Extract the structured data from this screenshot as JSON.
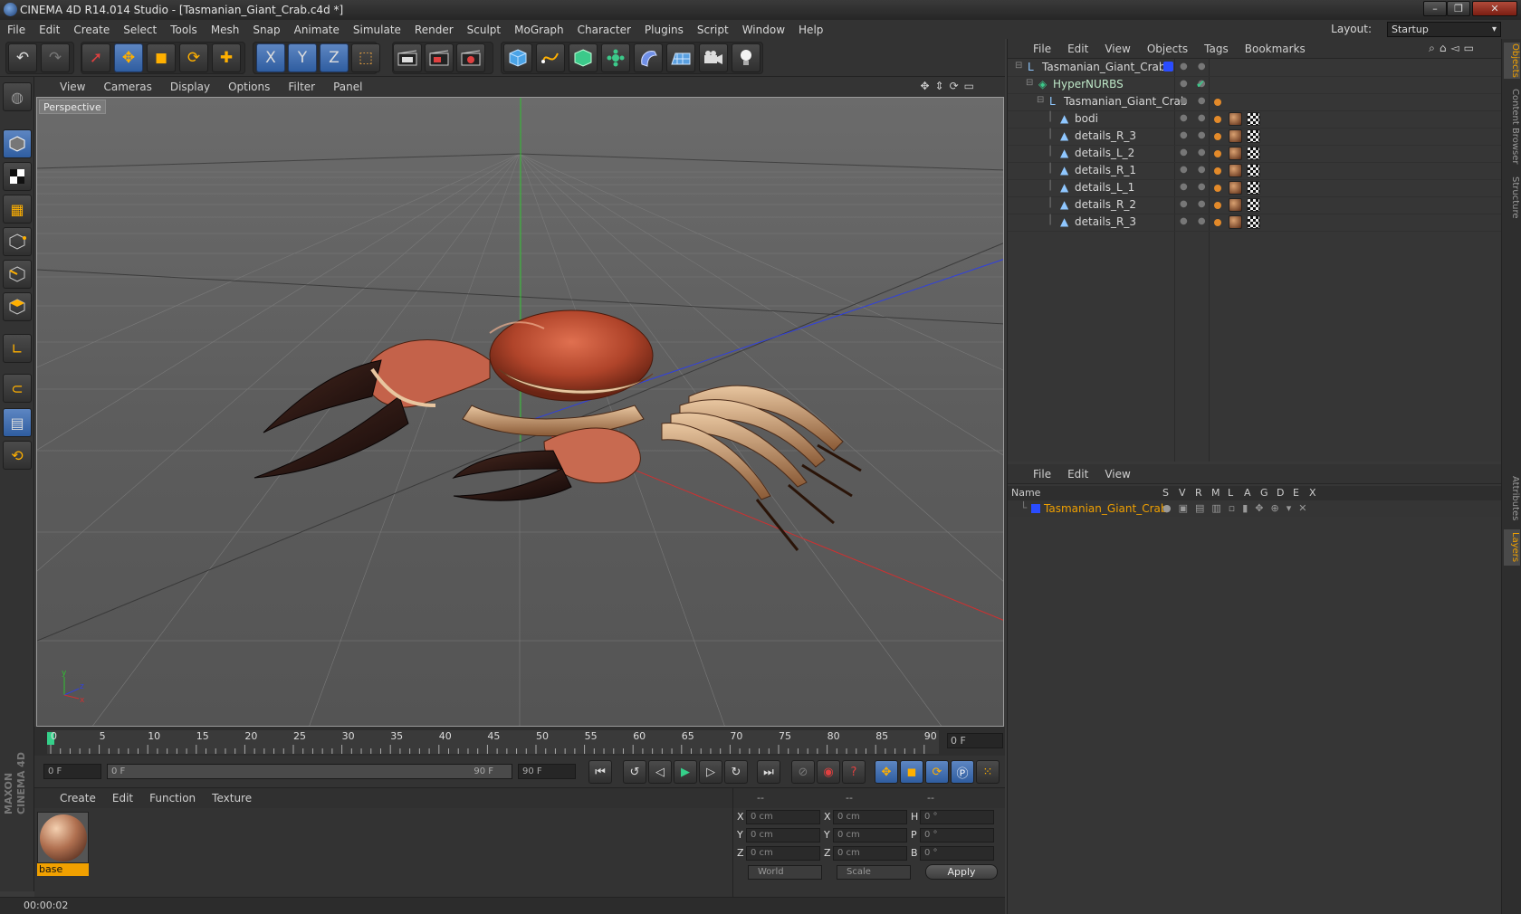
{
  "window": {
    "title": "CINEMA 4D R14.014 Studio - [Tasmanian_Giant_Crab.c4d *]",
    "minimize": "–",
    "restore": "❐",
    "close": "✕"
  },
  "menubar": {
    "items": [
      "File",
      "Edit",
      "Create",
      "Select",
      "Tools",
      "Mesh",
      "Snap",
      "Animate",
      "Simulate",
      "Render",
      "Sculpt",
      "MoGraph",
      "Character",
      "Plugins",
      "Script",
      "Window",
      "Help"
    ],
    "layout_label": "Layout:",
    "layout_value": "Startup"
  },
  "toolbar": {
    "undo": "↶",
    "redo": "↷",
    "select": "➚",
    "move": "✥",
    "scale": "◼",
    "rotate": "⟳",
    "add": "✚",
    "axis_x": "X",
    "axis_y": "Y",
    "axis_z": "Z",
    "coord": "⬚"
  },
  "viewport": {
    "menu": [
      "View",
      "Cameras",
      "Display",
      "Options",
      "Filter",
      "Panel"
    ],
    "label": "Perspective"
  },
  "timeline": {
    "ticks": [
      "0",
      "5",
      "10",
      "15",
      "20",
      "25",
      "30",
      "35",
      "40",
      "45",
      "50",
      "55",
      "60",
      "65",
      "70",
      "75",
      "80",
      "85",
      "90"
    ],
    "current_frame": "0 F",
    "start_field": "0 F",
    "range_start": "0 F",
    "range_end": "90 F",
    "end_field": "90 F"
  },
  "materials": {
    "menu": [
      "Create",
      "Edit",
      "Function",
      "Texture"
    ],
    "items": [
      {
        "name": "base"
      }
    ]
  },
  "coordinates": {
    "headers": [
      "--",
      "--",
      "--"
    ],
    "rows": [
      {
        "l1": "X",
        "v1": "0 cm",
        "l2": "X",
        "v2": "0 cm",
        "l3": "H",
        "v3": "0 °"
      },
      {
        "l1": "Y",
        "v1": "0 cm",
        "l2": "Y",
        "v2": "0 cm",
        "l3": "P",
        "v3": "0 °"
      },
      {
        "l1": "Z",
        "v1": "0 cm",
        "l2": "Z",
        "v2": "0 cm",
        "l3": "B",
        "v3": "0 °"
      }
    ],
    "space": "World",
    "mode": "Scale",
    "apply": "Apply"
  },
  "status": {
    "text": "00:00:02"
  },
  "objects_panel": {
    "menu": [
      "File",
      "Edit",
      "View",
      "Objects",
      "Tags",
      "Bookmarks"
    ],
    "tree": [
      {
        "name": "Tasmanian_Giant_Crab",
        "depth": 0,
        "type": "null"
      },
      {
        "name": "HyperNURBS",
        "depth": 1,
        "type": "nurbs"
      },
      {
        "name": "Tasmanian_Giant_Crab",
        "depth": 2,
        "type": "null"
      },
      {
        "name": "bodi",
        "depth": 3,
        "type": "mesh"
      },
      {
        "name": "details_R_3",
        "depth": 3,
        "type": "mesh"
      },
      {
        "name": "details_L_2",
        "depth": 3,
        "type": "mesh"
      },
      {
        "name": "details_R_1",
        "depth": 3,
        "type": "mesh"
      },
      {
        "name": "details_L_1",
        "depth": 3,
        "type": "mesh"
      },
      {
        "name": "details_R_2",
        "depth": 3,
        "type": "mesh"
      },
      {
        "name": "details_R_3",
        "depth": 3,
        "type": "mesh"
      }
    ]
  },
  "layers_panel": {
    "menu": [
      "File",
      "Edit",
      "View"
    ],
    "columns": [
      "Name",
      "S",
      "V",
      "R",
      "M",
      "L",
      "A",
      "G",
      "D",
      "E",
      "X"
    ],
    "layers": [
      {
        "name": "Tasmanian_Giant_Crab",
        "color": "#2a4cff"
      }
    ]
  },
  "side_tabs": [
    "Objects",
    "Content Browser",
    "Structure",
    "Attributes",
    "Layers"
  ],
  "colors": {
    "accent": "#3c6fb8",
    "layer_name": "#f0a000",
    "x_axis": "#d03030",
    "y_axis": "#30c030",
    "z_axis": "#3040e0"
  }
}
